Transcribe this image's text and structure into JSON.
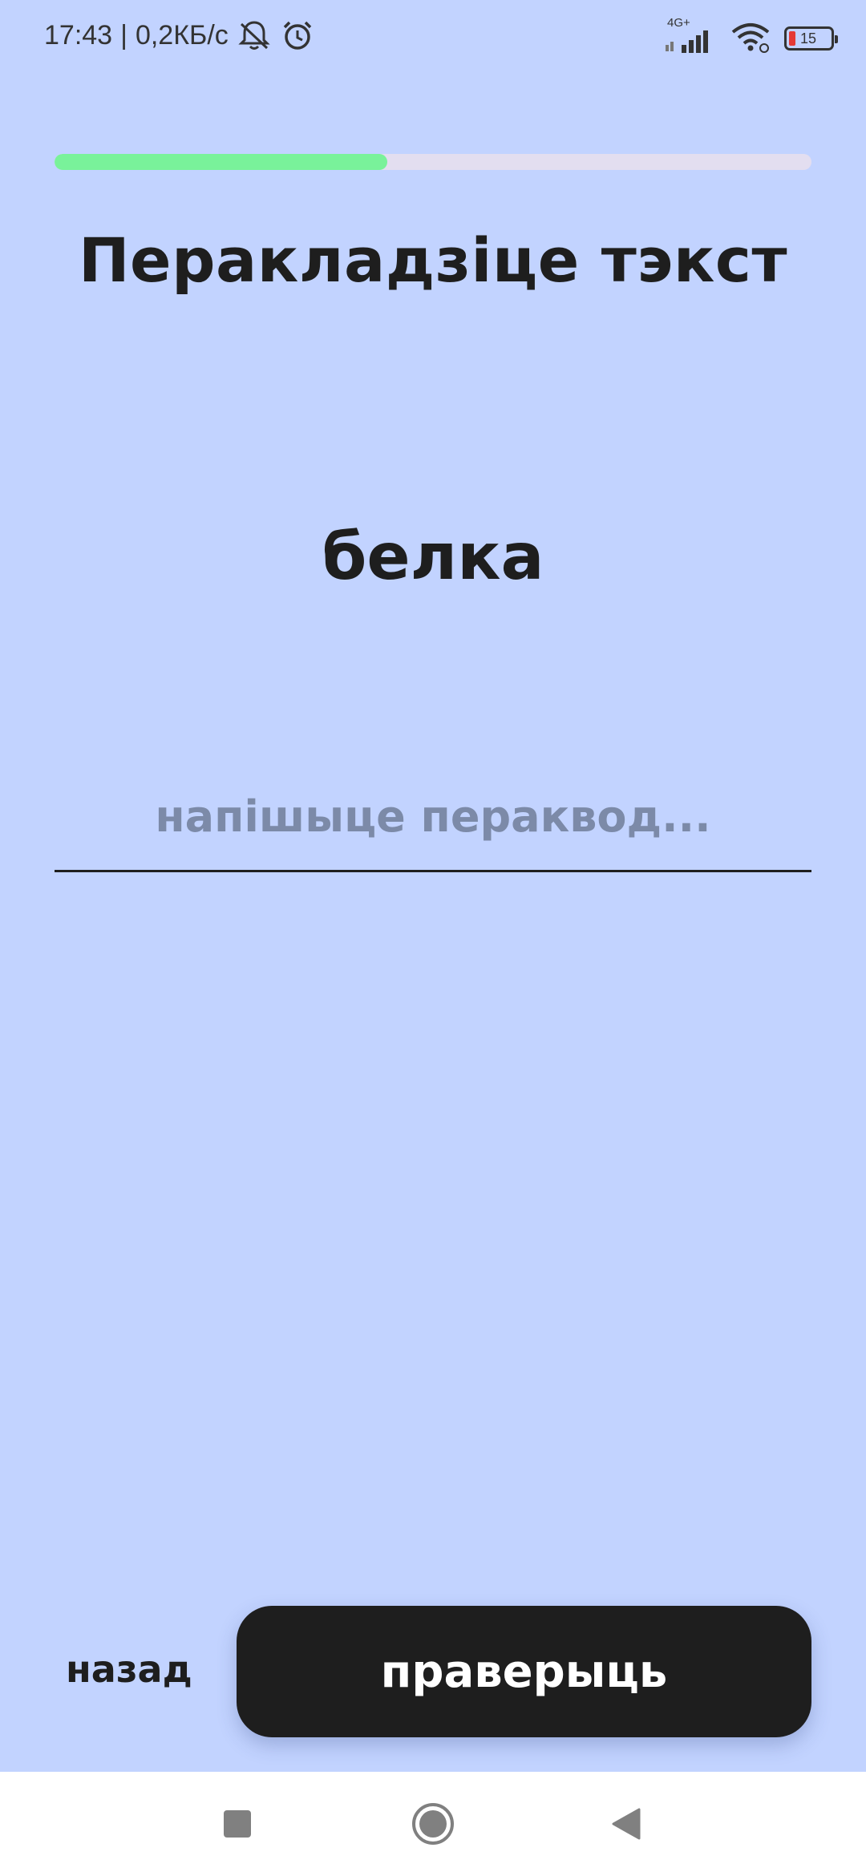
{
  "status_bar": {
    "time": "17:43",
    "separator": "|",
    "speed": "0,2КБ/с",
    "network_type": "4G+",
    "battery": "15",
    "icons": [
      "mute-notifications-icon",
      "alarm-icon",
      "signal-icon",
      "wifi-icon",
      "battery-icon"
    ]
  },
  "progress": {
    "value": 0.44,
    "fill_color": "#79f29a",
    "track_color": "#e3def0"
  },
  "exercise": {
    "title": "Перакладзіце тэкст",
    "word": "белка"
  },
  "answer": {
    "value": "",
    "placeholder": "напішыце пераквод..."
  },
  "actions": {
    "back_label": "назад",
    "check_label": "праверыць"
  },
  "navigation": {
    "icons": [
      "recent-apps-icon",
      "home-icon",
      "back-icon"
    ]
  },
  "colors": {
    "background": "#c2d3ff",
    "text": "#1e1e1e",
    "button": "#1e1e1e",
    "placeholder": "#7c8aa8"
  }
}
